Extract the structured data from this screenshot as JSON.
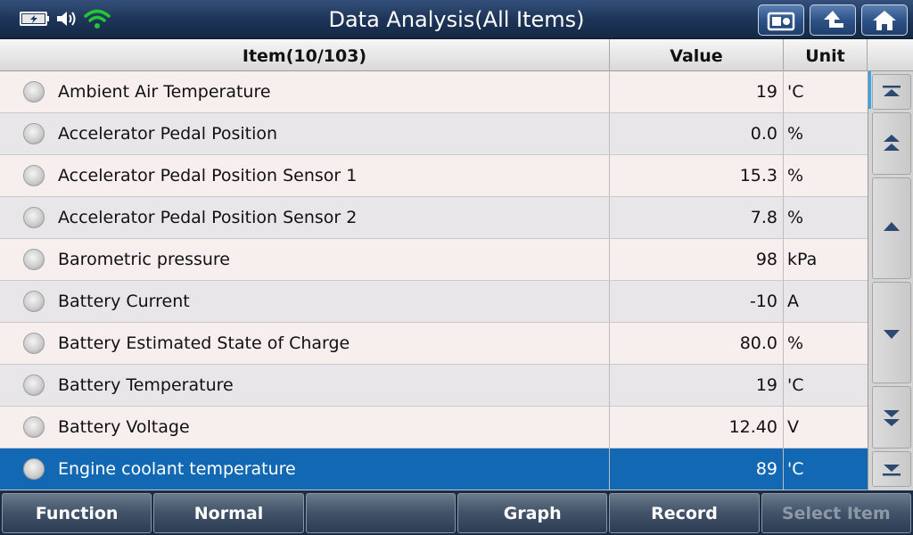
{
  "header": {
    "title": "Data Analysis(All Items)",
    "status_icons": [
      "battery-charging-icon",
      "speaker-icon",
      "wifi-icon"
    ],
    "buttons": [
      "screenshot-icon",
      "back-arrow-icon",
      "home-icon"
    ]
  },
  "table": {
    "columns": {
      "item": "Item(10/103)",
      "value": "Value",
      "unit": "Unit"
    },
    "rows": [
      {
        "name": "Ambient Air Temperature",
        "value": "19",
        "unit": "'C"
      },
      {
        "name": "Accelerator Pedal Position",
        "value": "0.0",
        "unit": "%"
      },
      {
        "name": "Accelerator Pedal Position Sensor 1",
        "value": "15.3",
        "unit": "%"
      },
      {
        "name": "Accelerator Pedal Position Sensor 2",
        "value": "7.8",
        "unit": "%"
      },
      {
        "name": "Barometric pressure",
        "value": "98",
        "unit": "kPa"
      },
      {
        "name": "Battery Current",
        "value": "-10",
        "unit": "A"
      },
      {
        "name": "Battery Estimated State of Charge",
        "value": "80.0",
        "unit": "%"
      },
      {
        "name": "Battery Temperature",
        "value": "19",
        "unit": "'C"
      },
      {
        "name": "Battery Voltage",
        "value": "12.40",
        "unit": "V"
      },
      {
        "name": "Engine coolant temperature",
        "value": "89",
        "unit": "'C"
      }
    ],
    "selected_index": 9
  },
  "scroll_buttons": [
    "scroll-top-icon",
    "page-up-icon",
    "line-up-icon",
    "line-down-icon",
    "page-down-icon",
    "scroll-bottom-icon"
  ],
  "toolbar": {
    "function": "Function",
    "normal": "Normal",
    "empty": "",
    "graph": "Graph",
    "record": "Record",
    "select_item": "Select Item"
  },
  "colors": {
    "selected_row": "#1268b3",
    "title_bar": "#1e3559",
    "wifi": "#22c832"
  }
}
